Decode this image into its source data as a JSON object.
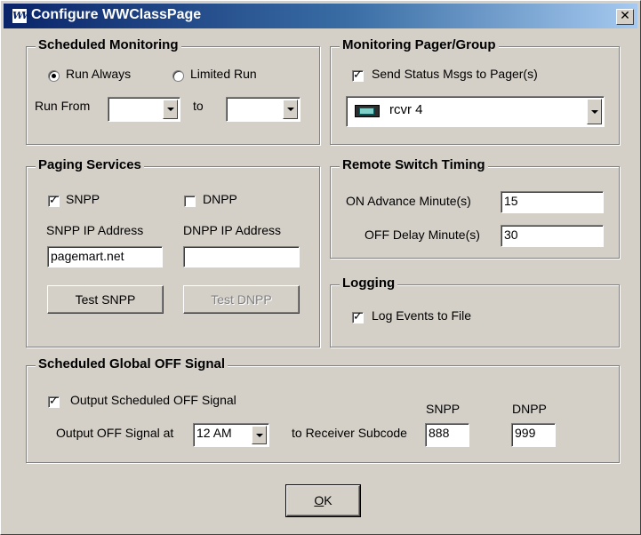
{
  "window": {
    "title": "Configure WWClassPage",
    "icon": "WW",
    "close_symbol": "✕"
  },
  "scheduled_monitoring": {
    "title": "Scheduled Monitoring",
    "run_always_label": "Run Always",
    "run_always_selected": true,
    "limited_run_label": "Limited Run",
    "run_from_label": "Run From",
    "run_from_value": "",
    "to_label": "to",
    "to_value": ""
  },
  "monitoring_pager": {
    "title": "Monitoring Pager/Group",
    "send_status_label": "Send Status Msgs to Pager(s)",
    "send_status_checked": true,
    "pager_value": "rcvr 4",
    "pager_icon": "pager-icon"
  },
  "paging_services": {
    "title": "Paging Services",
    "snpp_label": "SNPP",
    "snpp_checked": true,
    "dnpp_label": "DNPP",
    "dnpp_checked": false,
    "snpp_ip_label": "SNPP IP Address",
    "snpp_ip_value": "pagemart.net",
    "dnpp_ip_label": "DNPP IP Address",
    "dnpp_ip_value": "",
    "test_snpp_label": "Test SNPP",
    "test_dnpp_label": "Test DNPP"
  },
  "remote_switch": {
    "title": "Remote Switch Timing",
    "on_advance_label": "ON Advance Minute(s)",
    "on_advance_value": "15",
    "off_delay_label": "OFF Delay Minute(s)",
    "off_delay_value": "30"
  },
  "logging": {
    "title": "Logging",
    "log_events_label": "Log Events to File",
    "log_events_checked": true
  },
  "global_off": {
    "title": "Scheduled Global OFF Signal",
    "output_scheduled_label": "Output Scheduled OFF Signal",
    "output_scheduled_checked": true,
    "output_at_label": "Output OFF Signal at",
    "output_at_value": "12 AM",
    "to_receiver_label": "to Receiver Subcode",
    "snpp_header": "SNPP",
    "dnpp_header": "DNPP",
    "snpp_value": "888",
    "dnpp_value": "999"
  },
  "ok_button": {
    "label": "OK",
    "mnemonic": "O"
  },
  "colors": {
    "titlebar_start": "#0a246a",
    "titlebar_end": "#a6caf0",
    "face": "#d4d0c8"
  }
}
